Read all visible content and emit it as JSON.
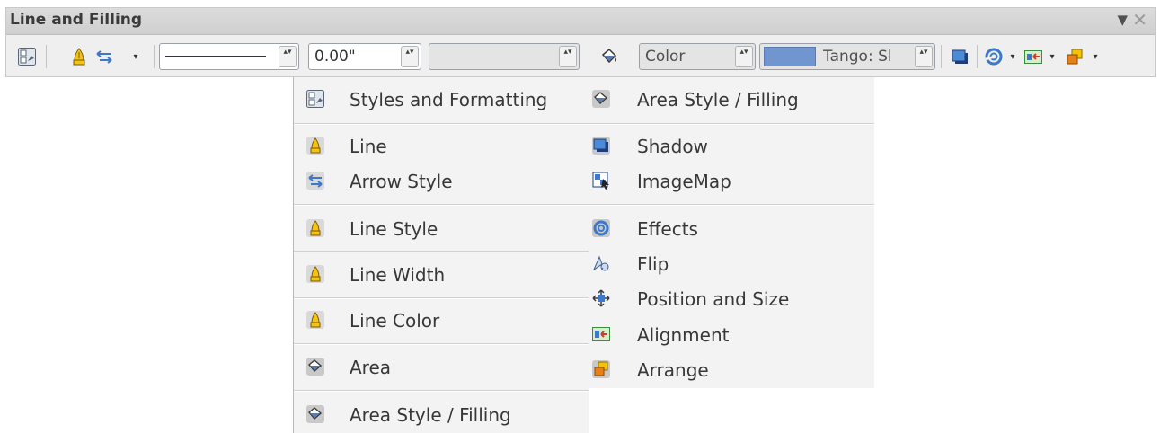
{
  "window": {
    "title": "Line and Filling",
    "menu_arrow": "▼",
    "close_glyph": "✕"
  },
  "toolbar": {
    "line_style_value": "",
    "line_width_value": "0.00\"",
    "line_color_value": "",
    "area_type_value": "Color",
    "area_color_value": "Tango: Sl",
    "area_color_swatch": "#7196cf",
    "dropdown_arrow": "▾",
    "spin_glyph": "▴▾",
    "icons": {
      "styles": "styles-and-formatting-icon",
      "line": "line-icon",
      "arrow_style": "arrow-style-icon",
      "area": "area-style-filling-icon",
      "shadow": "shadow-icon",
      "effects": "effects-icon",
      "alignment": "alignment-icon",
      "arrange": "arrange-icon"
    }
  },
  "menu": {
    "left": [
      {
        "label": "Styles and Formatting",
        "icon": "styles-and-formatting-icon"
      },
      {
        "label": "Line",
        "icon": "line-icon"
      },
      {
        "label": "Arrow Style",
        "icon": "arrow-style-icon"
      },
      {
        "label": "Line Style",
        "icon": "line-style-icon"
      },
      {
        "label": "Line Width",
        "icon": "line-width-icon"
      },
      {
        "label": "Line Color",
        "icon": "line-color-icon"
      },
      {
        "label": "Area",
        "icon": "area-icon"
      },
      {
        "label": "Area Style / Filling",
        "icon": "area-style-filling-icon"
      }
    ],
    "right": [
      {
        "label": "Area Style / Filling",
        "icon": "area-style-filling-icon"
      },
      {
        "label": "Shadow",
        "icon": "shadow-icon"
      },
      {
        "label": "ImageMap",
        "icon": "imagemap-icon"
      },
      {
        "label": "Effects",
        "icon": "effects-icon"
      },
      {
        "label": "Flip",
        "icon": "flip-icon"
      },
      {
        "label": "Position and Size",
        "icon": "position-and-size-icon"
      },
      {
        "label": "Alignment",
        "icon": "alignment-icon"
      },
      {
        "label": "Arrange",
        "icon": "arrange-icon"
      }
    ]
  },
  "colors": {
    "pen_yellow": "#f2c318",
    "accent_blue": "#3d78c9",
    "arrange_orange": "#e8801a"
  }
}
